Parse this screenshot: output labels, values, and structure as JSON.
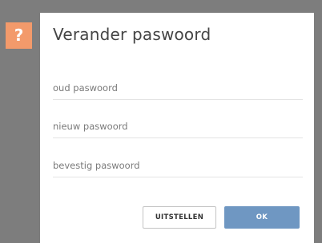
{
  "badge": {
    "glyph": "?",
    "icon": "question-icon",
    "color": "#f39a6b"
  },
  "dialog": {
    "title": "Verander paswoord",
    "fields": {
      "old_placeholder": "oud paswoord",
      "new_placeholder": "nieuw paswoord",
      "confirm_placeholder": "bevestig paswoord"
    },
    "buttons": {
      "cancel_label": "UITSTELLEN",
      "ok_label": "OK"
    }
  },
  "colors": {
    "backdrop": "#7d7d7d",
    "primary": "#6f97c2",
    "text": "#454545"
  }
}
